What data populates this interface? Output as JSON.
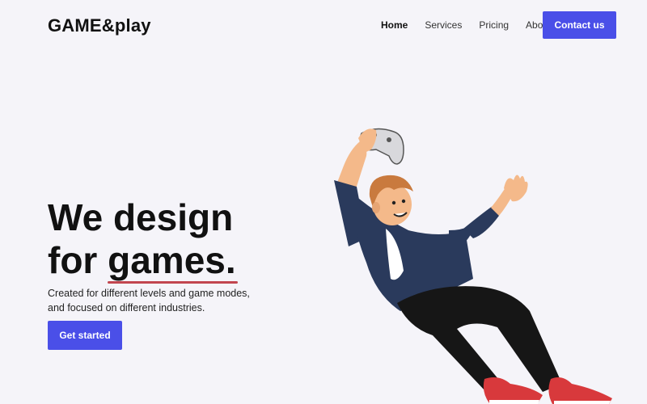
{
  "brand": {
    "logo": "GAME&play"
  },
  "nav": {
    "items": [
      {
        "label": "Home",
        "active": true
      },
      {
        "label": "Services",
        "active": false
      },
      {
        "label": "Pricing",
        "active": false
      },
      {
        "label": "About",
        "active": false
      }
    ],
    "contact_label": "Contact us"
  },
  "hero": {
    "title_line1": "We design",
    "title_line2_prefix": "for ",
    "title_highlight": "games.",
    "subtitle": "Created for different levels and game modes, and focused on different industries.",
    "cta_label": "Get started"
  },
  "colors": {
    "accent": "#4a4fe8",
    "underline": "#c2464f",
    "background": "#f5f4f9"
  },
  "illustration": {
    "icon": "gamer-with-controller-illustration"
  }
}
